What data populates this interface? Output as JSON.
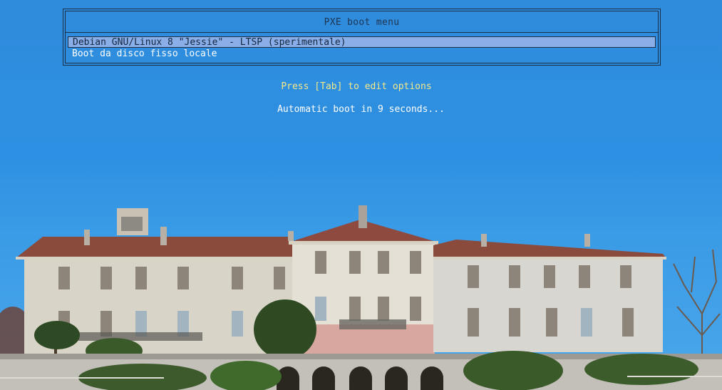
{
  "menu": {
    "title": "PXE boot menu",
    "items": [
      {
        "label": "Debian GNU/Linux 8 \"Jessie\" - LTSP (sperimentale)",
        "selected": true
      },
      {
        "label": "Boot da disco fisso locale",
        "selected": false
      }
    ]
  },
  "hints": {
    "edit": "Press [Tab] to edit options",
    "autoboot": "Automatic boot in 9 seconds..."
  },
  "colors": {
    "sky": "#2e90e2",
    "selection": "#8aaee8",
    "hint_yellow": "#f3e98a",
    "title_dark": "#1e3552"
  },
  "background": {
    "subject": "villa-photo"
  }
}
